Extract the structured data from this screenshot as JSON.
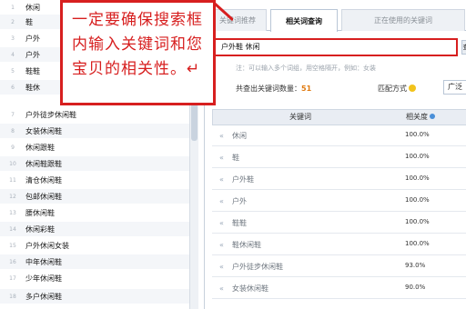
{
  "left_list": [
    {
      "n": "1",
      "word": "休闲"
    },
    {
      "n": "2",
      "word": "鞋"
    },
    {
      "n": "3",
      "word": "户外"
    },
    {
      "n": "4",
      "word": "户外"
    },
    {
      "n": "5",
      "word": "鞋鞋"
    },
    {
      "n": "6",
      "word": "鞋休"
    },
    {
      "n": "7",
      "word": "户外徒步休闲鞋"
    },
    {
      "n": "8",
      "word": "女装休闲鞋"
    },
    {
      "n": "9",
      "word": "休闲跟鞋"
    },
    {
      "n": "10",
      "word": "休闲鞋跟鞋"
    },
    {
      "n": "11",
      "word": "清仓休闲鞋"
    },
    {
      "n": "12",
      "word": "包邮休闲鞋"
    },
    {
      "n": "13",
      "word": "腰休闲鞋"
    },
    {
      "n": "14",
      "word": "休闲彩鞋"
    },
    {
      "n": "15",
      "word": "户外休闲女装"
    },
    {
      "n": "16",
      "word": "中年休闲鞋"
    },
    {
      "n": "17",
      "word": "少年休闲鞋"
    },
    {
      "n": "18",
      "word": "多户休闲鞋"
    }
  ],
  "callout": {
    "text": "一定要确保搜索框内输入关键词和您宝贝的相关性。↵"
  },
  "tabs": [
    {
      "label": "关键词推荐"
    },
    {
      "label": "相关词查询"
    },
    {
      "label": "正在使用的关键词"
    }
  ],
  "search": {
    "value": "户外鞋 休闲",
    "button_label": "查"
  },
  "hint": "注：可以输入多个词组，用空格隔开，例如：女装",
  "count": {
    "label": "共查出关键词数量：",
    "value": "51"
  },
  "match": {
    "label": "匹配方式",
    "select_value": "广泛"
  },
  "table": {
    "headers": {
      "keyword": "关键词",
      "relevance": "相关度"
    },
    "rows": [
      {
        "keyword": "休闲",
        "relevance": "100.0%"
      },
      {
        "keyword": "鞋",
        "relevance": "100.0%"
      },
      {
        "keyword": "户外鞋",
        "relevance": "100.0%"
      },
      {
        "keyword": "户外",
        "relevance": "100.0%"
      },
      {
        "keyword": "鞋鞋",
        "relevance": "100.0%"
      },
      {
        "keyword": "鞋休闲鞋",
        "relevance": "100.0%"
      },
      {
        "keyword": "户外徒步休闲鞋",
        "relevance": "93.0%"
      },
      {
        "keyword": "女装休闲鞋",
        "relevance": "90.0%"
      }
    ]
  },
  "colors": {
    "callout_red": "#d71f1f",
    "count_orange": "#e07a10"
  }
}
